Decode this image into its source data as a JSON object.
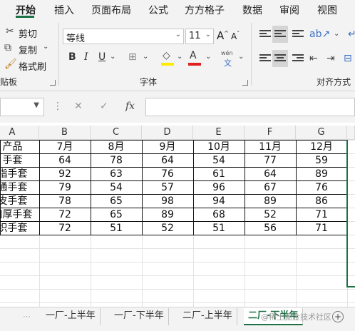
{
  "menu": {
    "tabs": [
      "开始",
      "插入",
      "页面布局",
      "公式",
      "方方格子",
      "数据",
      "审阅",
      "视图"
    ],
    "active_index": 0
  },
  "ribbon": {
    "clipboard": {
      "cut": "剪切",
      "copy": "复制",
      "format_painter": "格式刷",
      "group_label": "贴板"
    },
    "font": {
      "font_name": "等线",
      "font_size": "11",
      "group_label": "字体",
      "bold": "B",
      "italic": "I",
      "underline": "U",
      "increase": "A",
      "decrease": "A",
      "font_color_letter": "A",
      "phonetic_top": "wén",
      "phonetic_bottom": "文"
    },
    "alignment": {
      "group_label": "对齐方式"
    }
  },
  "formula_bar": {
    "fx_label": "fx",
    "cancel": "✕",
    "confirm": "✓"
  },
  "grid": {
    "columns": [
      "A",
      "B",
      "C",
      "D",
      "E",
      "F",
      "G"
    ],
    "header_row": [
      "产品",
      "7月",
      "8月",
      "9月",
      "10月",
      "11月",
      "12月"
    ],
    "rows": [
      [
        "手套",
        "64",
        "78",
        "64",
        "54",
        "77",
        "59"
      ],
      [
        "指手套",
        "92",
        "63",
        "76",
        "61",
        "64",
        "89"
      ],
      [
        "通手套",
        "79",
        "54",
        "57",
        "96",
        "67",
        "76"
      ],
      [
        "皮手套",
        "78",
        "65",
        "98",
        "94",
        "89",
        "86"
      ],
      [
        "加厚手套",
        "72",
        "65",
        "89",
        "68",
        "52",
        "71"
      ],
      [
        "织手套",
        "72",
        "51",
        "52",
        "51",
        "56",
        "71"
      ]
    ]
  },
  "sheets": {
    "tabs": [
      "一厂-上半年",
      "一厂-下半年",
      "二厂-上半年",
      "二厂-下半年"
    ],
    "active_index": 3,
    "add_icon": "+"
  },
  "watermark": "@稀土掘金技术社区"
}
